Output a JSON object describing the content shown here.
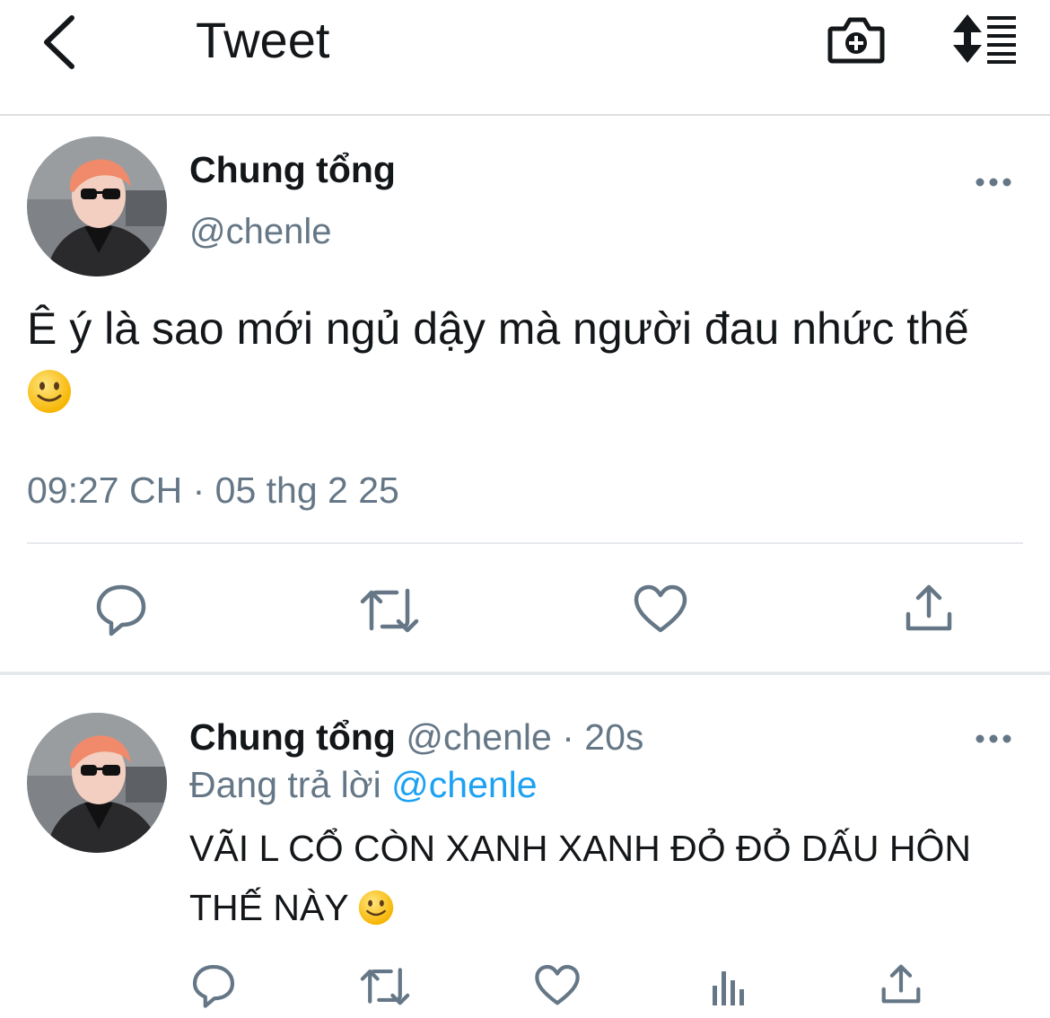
{
  "header": {
    "back_icon": "chevron-left-icon",
    "title": "Tweet",
    "camera_icon": "camera-plus-icon",
    "sort_icon": "sort-list-icon"
  },
  "main_tweet": {
    "display_name": "Chung tổng",
    "handle": "@chenle",
    "text_part1": "Ê ý là sao mới ngủ dậy mà người đau nhức thế",
    "emoji": "slightly-smiling-face",
    "meta": "09:27 CH · 05 thg 2 25",
    "actions": [
      "reply-icon",
      "retweet-icon",
      "like-icon",
      "share-icon"
    ]
  },
  "reply_tweet": {
    "display_name": "Chung tổng",
    "handle": "@chenle",
    "separator": "·",
    "time": "20s",
    "replying_prefix": "Đang trả lời",
    "replying_to": "@chenle",
    "text": "VÃI L CỔ CÒN XANH XANH ĐỎ ĐỎ DẤU HÔN THẾ NÀY",
    "emoji": "slightly-smiling-face",
    "actions": [
      "reply-icon",
      "retweet-icon",
      "like-icon",
      "stats-icon",
      "share-icon"
    ]
  },
  "colors": {
    "text": "#14171a",
    "secondary": "#657786",
    "link": "#1da1f2",
    "divider": "#e6e9ec"
  }
}
